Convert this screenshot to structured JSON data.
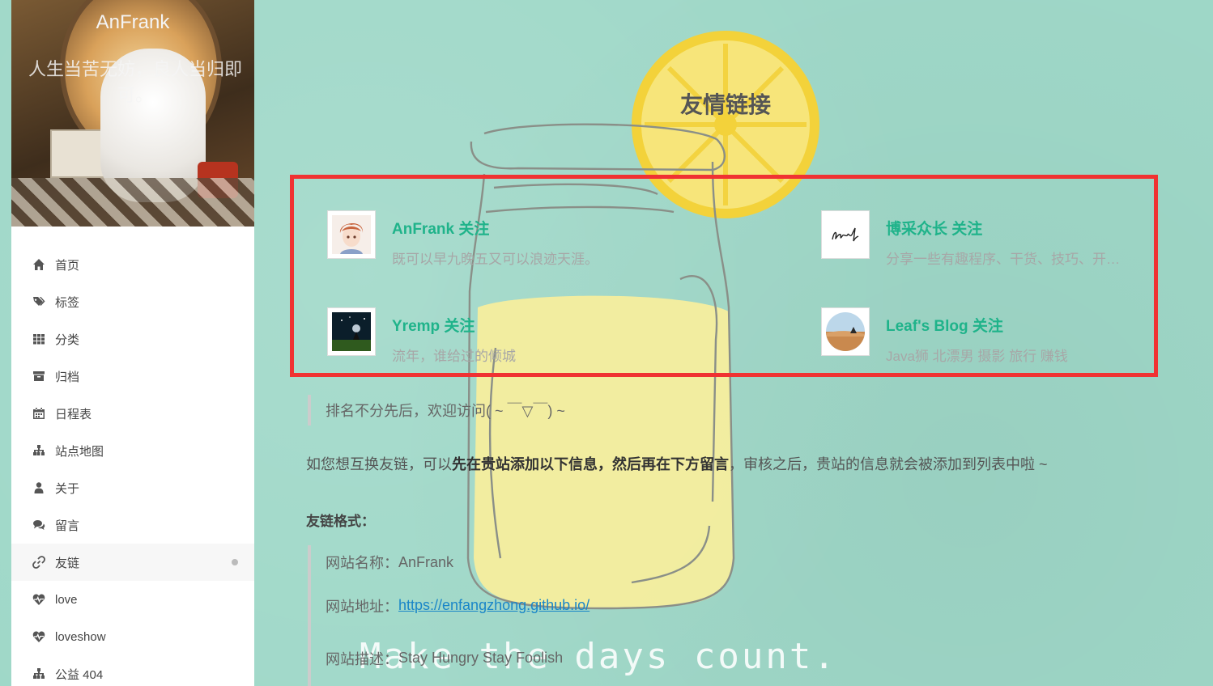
{
  "sidebar": {
    "brand": {
      "title": "AnFrank",
      "subtitle": "人生当苦无妨，良人当归即可。"
    },
    "menu": [
      {
        "label": "首页",
        "icon": "home-icon"
      },
      {
        "label": "标签",
        "icon": "tags-icon"
      },
      {
        "label": "分类",
        "icon": "grid-icon"
      },
      {
        "label": "归档",
        "icon": "archive-icon"
      },
      {
        "label": "日程表",
        "icon": "calendar-icon"
      },
      {
        "label": "站点地图",
        "icon": "sitemap-icon"
      },
      {
        "label": "关于",
        "icon": "user-icon"
      },
      {
        "label": "留言",
        "icon": "comments-icon"
      },
      {
        "label": "友链",
        "icon": "link-icon",
        "active": true
      },
      {
        "label": "love",
        "icon": "heartbeat-icon"
      },
      {
        "label": "loveshow",
        "icon": "heartbeat-icon"
      },
      {
        "label": "公益 404",
        "icon": "sitemap-icon"
      }
    ]
  },
  "main": {
    "title": "友情链接",
    "links": [
      {
        "name": "AnFrank 关注",
        "desc": "既可以早九晚五又可以浪迹天涯。",
        "avatar": "anime-boy-avatar"
      },
      {
        "name": "博采众长 关注",
        "desc": "分享一些有趣程序、干货、技巧、开发工具",
        "avatar": "signature-avatar"
      },
      {
        "name": "Yremp 关注",
        "desc": "流年，谁给过的倾城",
        "avatar": "night-scene-avatar"
      },
      {
        "name": "Leaf's Blog 关注",
        "desc": "Java狮 北漂男 摄影 旅行 赚钱",
        "avatar": "desert-avatar"
      }
    ],
    "note": "排名不分先后，欢迎访问( ~ ￣▽￣) ~",
    "exchange": {
      "before": "如您想互换友链，可以",
      "bold": "先在贵站添加以下信息，然后再在下方留言",
      "after": "，审核之后，贵站的信息就会被添加到列表中啦 ~"
    },
    "format_title": "友链格式：",
    "format": {
      "name_label": "网站名称：",
      "name_value": "AnFrank",
      "url_label": "网站地址：",
      "url_value": "https://enfangzhong.github.io/",
      "desc_label": "网站描述：",
      "desc_value": "Stay Hungry Stay Foolish"
    },
    "background_caption": "Make the days count.",
    "colors": {
      "accent": "#1fb38a",
      "highlight_border": "#f03232",
      "background": "#9fd8c8",
      "link": "#1a86c8"
    }
  }
}
